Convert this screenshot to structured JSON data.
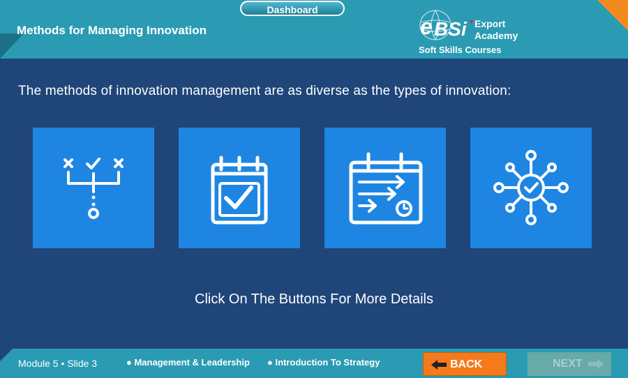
{
  "header": {
    "dashboard_label": "Dashboard",
    "title": "Methods for Managing Innovation",
    "logo": {
      "e": "e",
      "bsi": "BSi",
      "export": "Export",
      "academy": "Academy",
      "subtitle": "Soft Skills Courses"
    }
  },
  "main": {
    "intro": "The methods of innovation management are as diverse as the types of innovation:",
    "tiles": [
      {
        "icon": "decision-tree-icon"
      },
      {
        "icon": "calendar-check-icon"
      },
      {
        "icon": "calendar-schedule-icon"
      },
      {
        "icon": "network-hub-icon"
      }
    ],
    "hint": "Click On The Buttons For More Details"
  },
  "footer": {
    "module_info": "Module 5 • Slide 3",
    "crumb_1": "● Management & Leadership",
    "crumb_2": "● Introduction To Strategy",
    "back_label": "BACK",
    "next_label": "NEXT"
  },
  "colors": {
    "background": "#1f4579",
    "header": "#2a9bb3",
    "tile": "#1e86e2",
    "accent": "#f47a1b"
  }
}
